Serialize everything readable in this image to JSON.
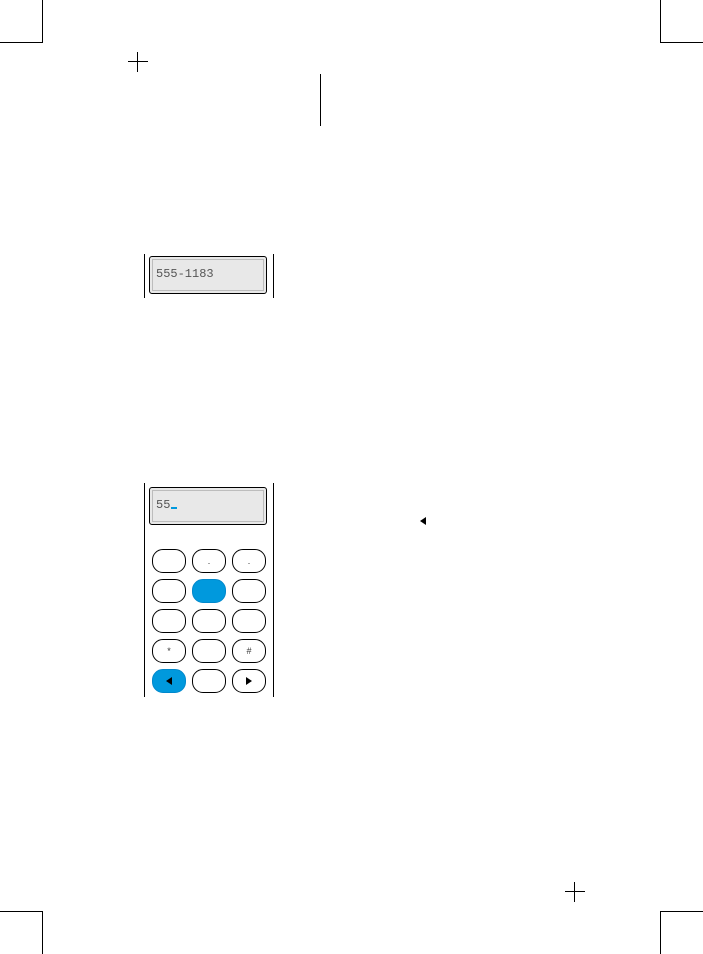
{
  "display1": {
    "line1": "",
    "line2": "555-1183"
  },
  "display2": {
    "line1": "",
    "line2": "55"
  },
  "keypad": {
    "rows": [
      [
        {
          "label": "",
          "active": false
        },
        {
          "label": ".",
          "active": false
        },
        {
          "label": ".",
          "active": false
        }
      ],
      [
        {
          "label": "",
          "active": false
        },
        {
          "label": "",
          "active": true
        },
        {
          "label": "",
          "active": false
        }
      ],
      [
        {
          "label": "",
          "active": false
        },
        {
          "label": "",
          "active": false
        },
        {
          "label": "",
          "active": false
        }
      ],
      [
        {
          "label": "*",
          "active": false
        },
        {
          "label": "",
          "active": false
        },
        {
          "label": "#",
          "active": false
        }
      ],
      [
        {
          "icon": "left",
          "active": true
        },
        {
          "label": "",
          "active": false
        },
        {
          "icon": "right",
          "active": false
        }
      ]
    ]
  }
}
